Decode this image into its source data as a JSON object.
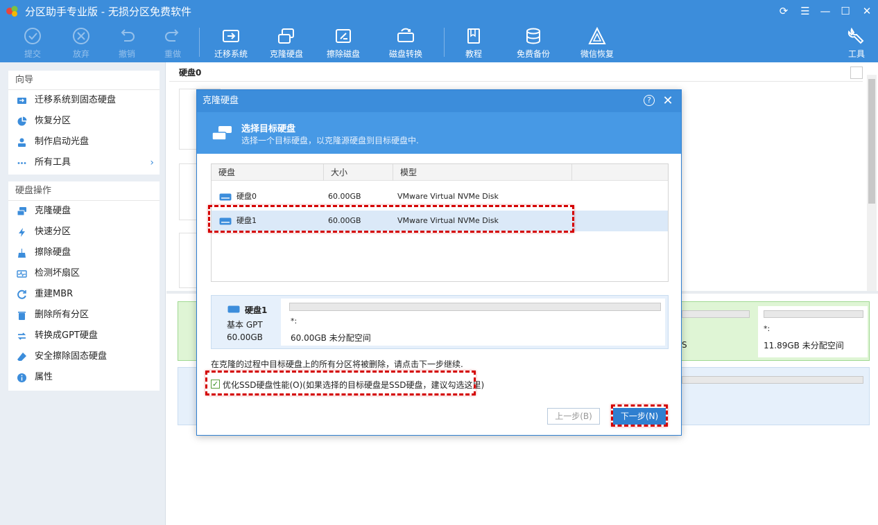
{
  "window": {
    "title": "分区助手专业版 - 无损分区免费软件"
  },
  "toolbar": {
    "commit": "提交",
    "discard": "放弃",
    "undo": "撤销",
    "redo": "重做",
    "migrate_os": "迁移系统",
    "clone_disk": "克隆硬盘",
    "wipe_disk": "擦除磁盘",
    "convert_disk": "磁盘转换",
    "tutorial": "教程",
    "free_backup": "免费备份",
    "wechat_recovery": "微信恢复",
    "tools": "工具"
  },
  "sidebar": {
    "wizard_title": "向导",
    "wizard_items": [
      "迁移系统到固态硬盘",
      "恢复分区",
      "制作启动光盘",
      "所有工具"
    ],
    "ops_title": "硬盘操作",
    "ops_items": [
      "克隆硬盘",
      "快速分区",
      "擦除硬盘",
      "检测坏扇区",
      "重建MBR",
      "删除所有分区",
      "转换成GPT硬盘",
      "安全擦除固态硬盘",
      "属性"
    ]
  },
  "main": {
    "disk_header": "硬盘0",
    "bg_part1": "*:",
    "bg_part1_desc": "11.89GB 未分配空间",
    "bg_frag_s": "S"
  },
  "dialog": {
    "title": "克隆硬盘",
    "help": "?",
    "header_title": "选择目标硬盘",
    "header_sub": "选择一个目标硬盘，以克隆源硬盘到目标硬盘中.",
    "columns": [
      "硬盘",
      "大小",
      "模型"
    ],
    "rows": [
      {
        "disk": "硬盘0",
        "size": "60.00GB",
        "model": "VMware Virtual NVMe Disk"
      },
      {
        "disk": "硬盘1",
        "size": "60.00GB",
        "model": "VMware Virtual NVMe Disk"
      }
    ],
    "selected_row": 1,
    "info": {
      "name": "硬盘1",
      "type": "基本 GPT",
      "size": "60.00GB",
      "part_label": "*:",
      "part_desc": "60.00GB 未分配空间"
    },
    "warning": "在克隆的过程中目标硬盘上的所有分区将被删除，请点击下一步继续.",
    "ssd_option": "优化SSD硬盘性能(O)(如果选择的目标硬盘是SSD硬盘，建议勾选这里)",
    "ssd_checked": true,
    "prev_button": "上一步(B)",
    "next_button": "下一步(N)"
  },
  "colors": {
    "accent": "#3c8ddb",
    "highlight": "#d40000",
    "selected_row": "#dbe9f8"
  }
}
